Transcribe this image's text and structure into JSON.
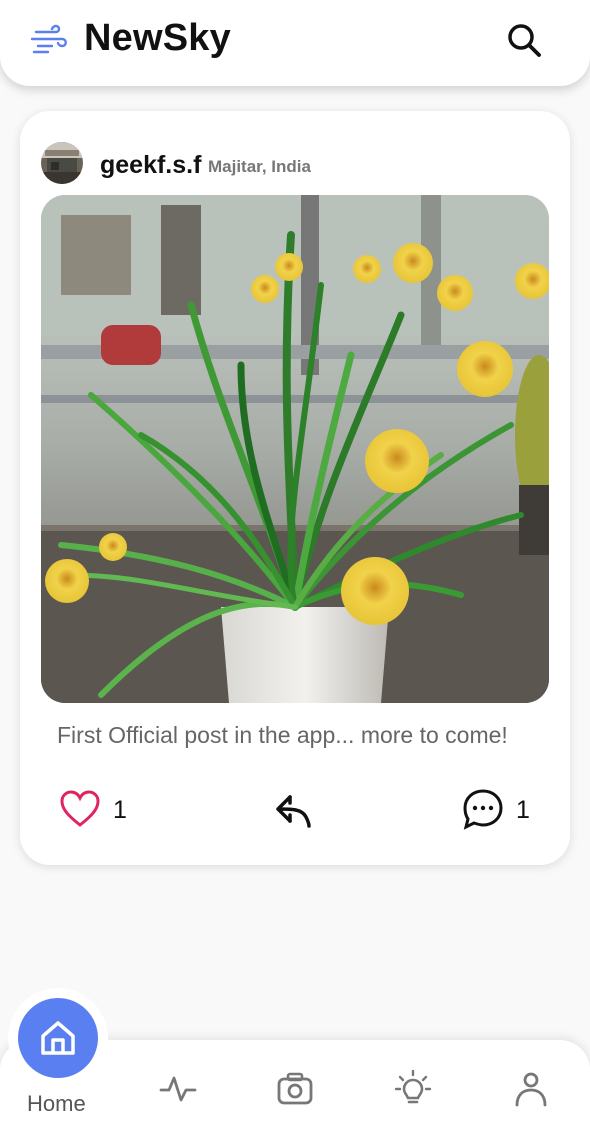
{
  "header": {
    "title": "NewSky",
    "logo_icon": "wind-icon",
    "search_icon": "search-icon"
  },
  "post": {
    "username": "geekf.s.f",
    "location": "Majitar, India",
    "image_alt": "Potted green plant with yellow flowers",
    "caption": "First Official post in the app... more to come!",
    "likes": "1",
    "comments": "1",
    "like_icon": "heart-icon",
    "share_icon": "share-icon",
    "comment_icon": "comment-icon"
  },
  "nav": {
    "home_label": "Home",
    "items": [
      "home-icon",
      "activity-icon",
      "camera-icon",
      "bulb-icon",
      "profile-icon"
    ]
  },
  "colors": {
    "accent": "#5a7ff0",
    "like": "#e0245e",
    "text": "#111111",
    "muted": "#777777"
  }
}
